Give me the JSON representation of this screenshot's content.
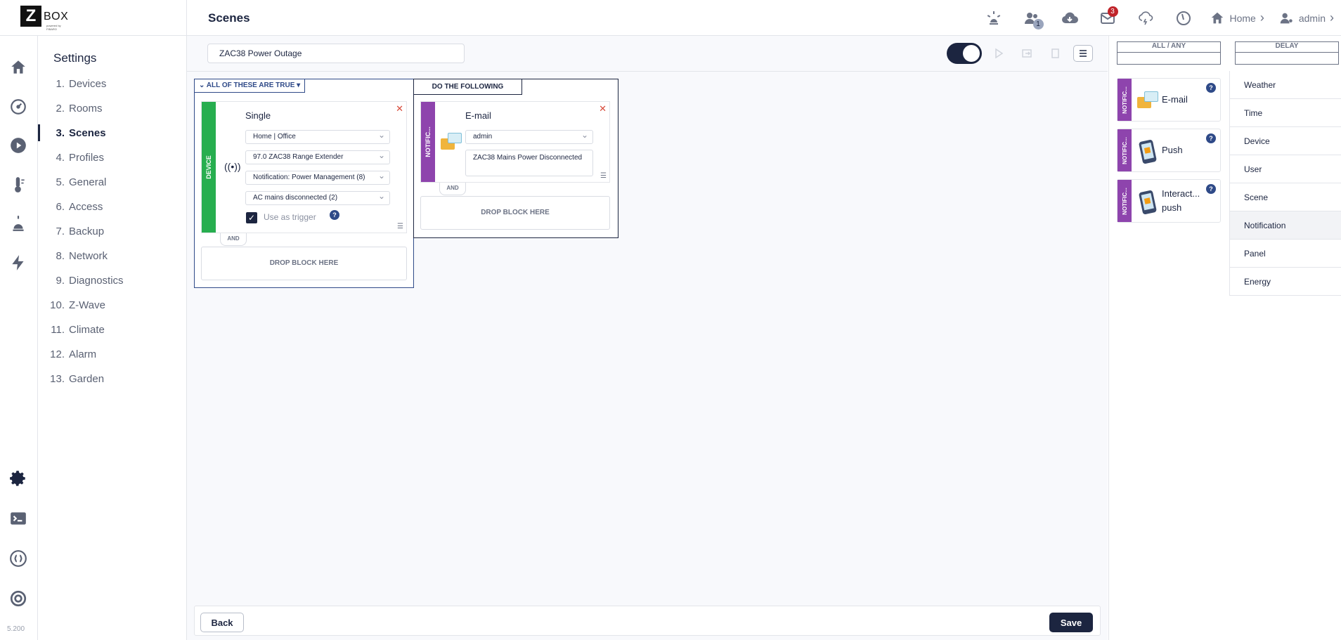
{
  "app": {
    "logo_letter": "Z",
    "logo_text": "BOX",
    "logo_sub": "powered by FIBARO",
    "page_title": "Scenes",
    "version": "5.200"
  },
  "topbar": {
    "users_badge": "1",
    "mail_badge": "3",
    "home_label": "Home",
    "user_label": "admin"
  },
  "settings": {
    "title": "Settings",
    "items": [
      {
        "num": "1.",
        "label": "Devices"
      },
      {
        "num": "2.",
        "label": "Rooms"
      },
      {
        "num": "3.",
        "label": "Scenes"
      },
      {
        "num": "4.",
        "label": "Profiles"
      },
      {
        "num": "5.",
        "label": "General"
      },
      {
        "num": "6.",
        "label": "Access"
      },
      {
        "num": "7.",
        "label": "Backup"
      },
      {
        "num": "8.",
        "label": "Network"
      },
      {
        "num": "9.",
        "label": "Diagnostics"
      },
      {
        "num": "10.",
        "label": "Z-Wave"
      },
      {
        "num": "11.",
        "label": "Climate"
      },
      {
        "num": "12.",
        "label": "Alarm"
      },
      {
        "num": "13.",
        "label": "Garden"
      }
    ]
  },
  "scene": {
    "name": "ZAC38 Power Outage",
    "enabled": true
  },
  "conditions": {
    "header": "ALL OF THESE ARE TRUE",
    "block": {
      "strip": "DEVICE",
      "strip_color": "#27ae4f",
      "title": "Single",
      "room": "Home | Office",
      "device": "97.0 ZAC38 Range Extender",
      "property": "Notification: Power Management (8)",
      "value": "AC mains disconnected (2)",
      "trigger_label": "Use as trigger",
      "trigger_checked": true
    },
    "and_label": "AND",
    "drop_label": "DROP BLOCK HERE"
  },
  "actions": {
    "header": "DO THE FOLLOWING",
    "block": {
      "strip": "NOTIFIC...",
      "strip_color": "#8e44ad",
      "title": "E-mail",
      "recipient": "admin",
      "message": "ZAC38 Mains Power Disconnected"
    },
    "and_label": "AND",
    "drop_label": "DROP BLOCK HERE"
  },
  "footer": {
    "back_label": "Back",
    "save_label": "Save"
  },
  "palette": {
    "col_all_any": "ALL / ANY",
    "col_delay": "DELAY",
    "blocks": [
      {
        "strip": "NOTIFIC...",
        "label": "E-mail",
        "icon": "email-icon"
      },
      {
        "strip": "NOTIFIC...",
        "label": "Push",
        "icon": "phone-icon"
      },
      {
        "strip": "NOTIFIC...",
        "label": "Interact... push",
        "icon": "phone-icon"
      }
    ],
    "categories": [
      "Weather",
      "Time",
      "Device",
      "User",
      "Scene",
      "Notification",
      "Panel",
      "Energy"
    ],
    "active_category": "Notification"
  },
  "colors": {
    "primary": "#1c2540",
    "device_green": "#27ae4f",
    "notification_purple": "#8e44ad",
    "badge_red": "#c0242a"
  }
}
